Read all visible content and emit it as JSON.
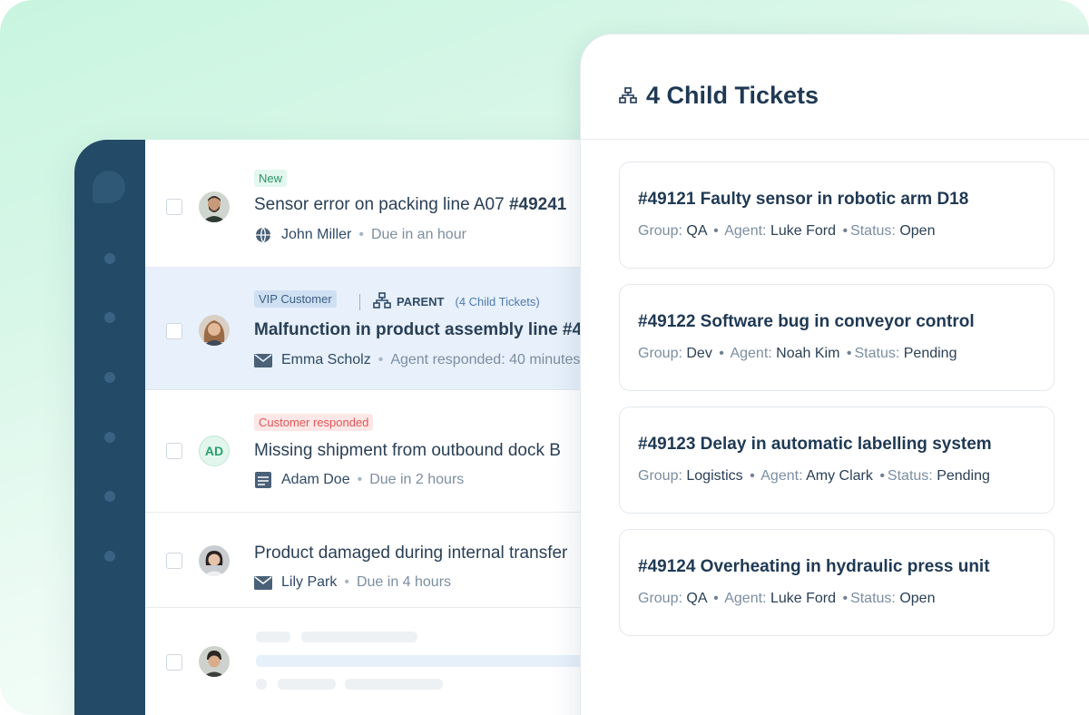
{
  "panel": {
    "title": "4 Child Tickets",
    "cards": [
      {
        "title": "#49121 Faulty sensor in robotic arm D18",
        "group": "QA",
        "agent": "Luke Ford",
        "status": "Open"
      },
      {
        "title": "#49122 Software bug in conveyor control",
        "group": "Dev",
        "agent": "Noah Kim",
        "status": "Pending"
      },
      {
        "title": "#49123 Delay in automatic labelling system",
        "group": "Logistics",
        "agent": "Amy Clark",
        "status": "Pending"
      },
      {
        "title": "#49124 Overheating in hydraulic press unit",
        "group": "QA",
        "agent": "Luke Ford",
        "status": "Open"
      }
    ],
    "labels": {
      "group": "Group:",
      "agent": "Agent:",
      "status": "Status:",
      "bullet": "•"
    }
  },
  "tickets": [
    {
      "tag": "New",
      "title_text": "Sensor error on packing line A07 ",
      "title_id": "#49241",
      "requester": "John Miller",
      "due": "Due in an hour",
      "channel_icon": "globe-icon"
    },
    {
      "tag": "VIP Customer",
      "parent_label": "PARENT",
      "parent_count": "(4 Child Tickets)",
      "title": "Malfunction in product assembly line #4",
      "requester": "Emma Scholz",
      "due": "Agent responded: 40 minutes",
      "channel_icon": "mail-icon"
    },
    {
      "tag": "Customer responded",
      "avatar_initials": "AD",
      "title": "Missing shipment from outbound dock B",
      "requester": "Adam Doe",
      "due": "Due in 2 hours",
      "channel_icon": "form-icon"
    },
    {
      "title": "Product damaged during internal transfer",
      "requester": "Lily Park",
      "due": "Due in 4 hours",
      "channel_icon": "mail-icon"
    }
  ],
  "colors": {
    "rail": "#234a66",
    "selected_row": "#e7f0fb",
    "accent_green": "#2a9e6c",
    "heading": "#1f3954"
  }
}
